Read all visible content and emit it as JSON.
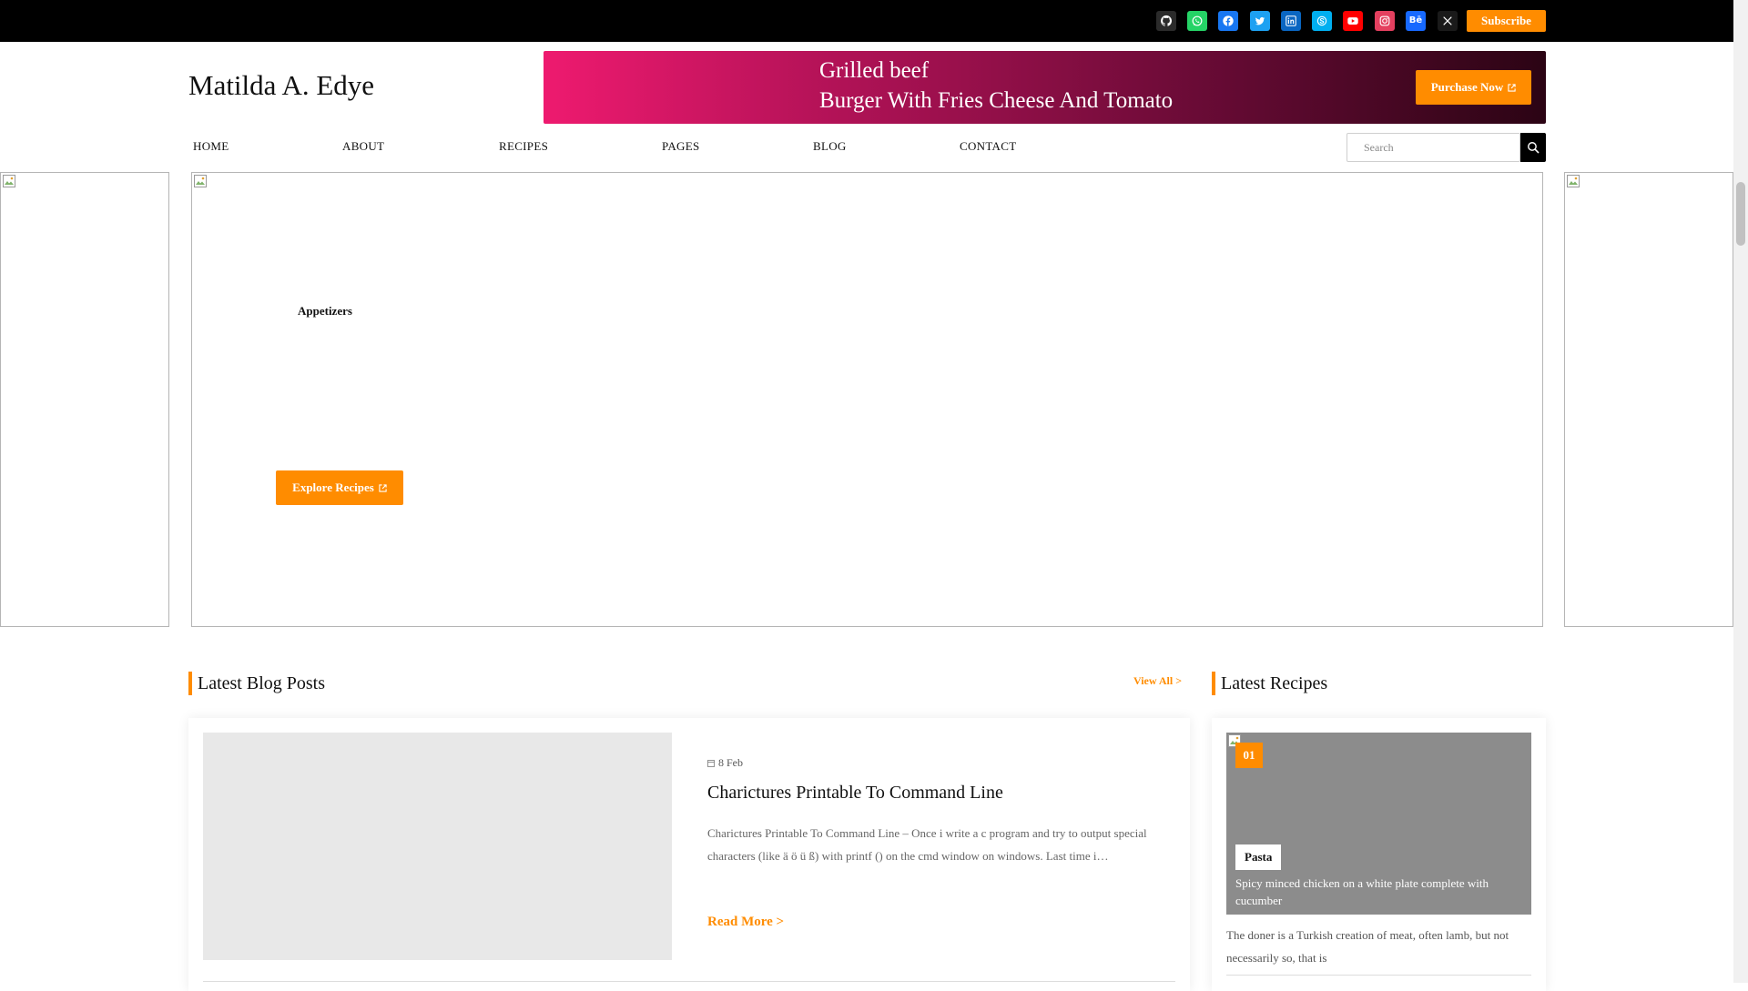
{
  "topbar": {
    "socials": [
      {
        "icon": "github-icon",
        "color": "#2b2b2b"
      },
      {
        "icon": "whatsapp-icon",
        "color": "#25d366"
      },
      {
        "icon": "facebook-icon",
        "color": "#1877f2"
      },
      {
        "icon": "twitter-icon",
        "color": "#1da1f2"
      },
      {
        "icon": "linkedin-icon",
        "color": "#0a66c2"
      },
      {
        "icon": "skype-icon",
        "color": "#00aff0"
      },
      {
        "icon": "youtube-icon",
        "color": "#ff0000"
      },
      {
        "icon": "instagram-icon",
        "color": "#e4405f"
      },
      {
        "icon": "behance-icon",
        "color": "#1769ff"
      },
      {
        "icon": "x-icon",
        "color": "#1a1a1a"
      }
    ],
    "subscribe_label": "Subscribe"
  },
  "header": {
    "site_title": "Matilda A. Edye",
    "banner": {
      "line1": "Grilled beef",
      "line2": "Burger With Fries Cheese And Tomato",
      "cta_label": "Purchase Now"
    }
  },
  "nav": {
    "items": [
      "HOME",
      "ABOUT",
      "RECIPES",
      "PAGES",
      "BLOG",
      "CONTACT"
    ],
    "search_placeholder": "Search"
  },
  "hero": {
    "category": "Appetizers",
    "cta_label": "Explore Recipes"
  },
  "blog": {
    "heading": "Latest Blog Posts",
    "view_all": "View All >",
    "post": {
      "date": "8 Feb",
      "title": "Charictures Printable To Command Line",
      "excerpt": "Charictures Printable To Command Line – Once i write a c program and try to output special characters (like ä ö ü ß) with printf () on the cmd window on windows. Last time i…",
      "read_more": "Read More >"
    }
  },
  "recipes": {
    "heading": "Latest Recipes",
    "item": {
      "number": "01",
      "tag": "Pasta",
      "caption": "Spicy minced chicken on a white plate complete with cucumber",
      "description": "The doner is a Turkish creation of meat, often lamb, but not necessarily so, that is"
    }
  },
  "colors": {
    "accent": "#ff8c00",
    "topbar": "#000000",
    "banner_start": "#ee1a6f",
    "banner_end": "#2b0414"
  }
}
